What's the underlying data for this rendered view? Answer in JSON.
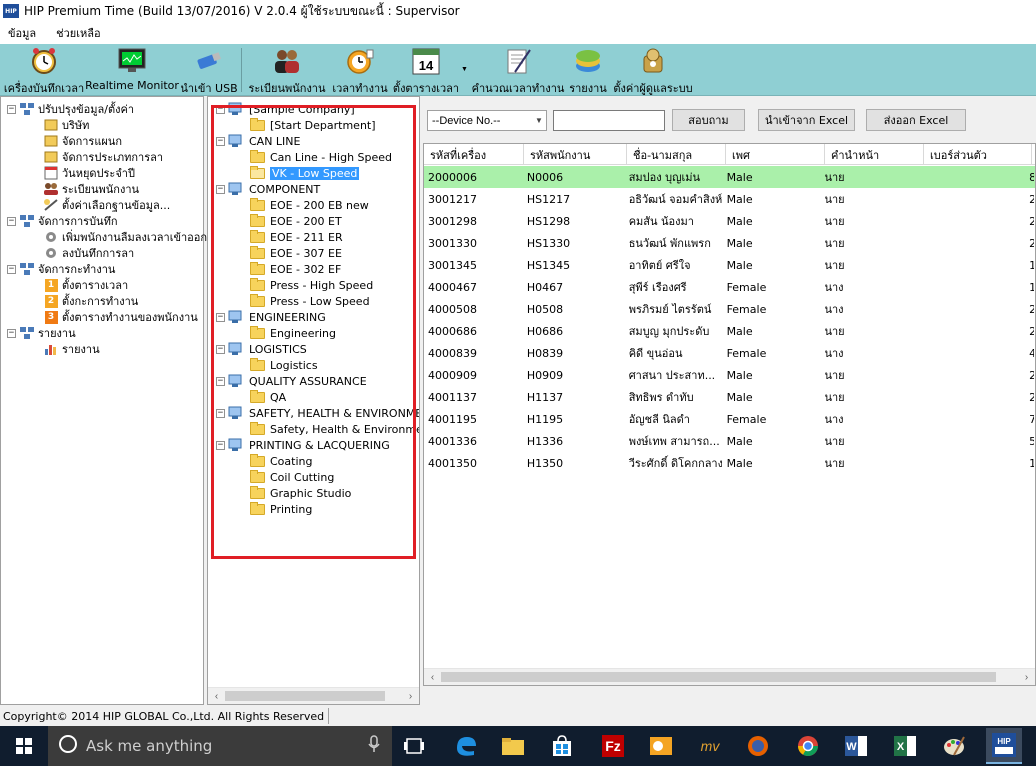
{
  "window": {
    "title": "HIP Premium Time (Build 13/07/2016) V 2.0.4   ผู้ใช้ระบบขณะนี้ : Supervisor",
    "app_icon_text": "HIP"
  },
  "menu": [
    "ข้อมูล",
    "ช่วยเหลือ"
  ],
  "toolbar": [
    {
      "label": "เครื่องบันทึกเวลา",
      "icon": "alarm-clock-icon"
    },
    {
      "label": "Realtime Monitor",
      "icon": "monitor-icon"
    },
    {
      "label": "นำเข้า USB",
      "icon": "usb-icon"
    },
    {
      "label": "ระเบียนพนักงาน",
      "icon": "users-icon"
    },
    {
      "label": "เวลาทำงาน",
      "icon": "clock-icon"
    },
    {
      "label": "ตั้งตารางเวลา",
      "icon": "calendar-icon",
      "calendar_day": "14"
    },
    {
      "label": "คำนวณเวลาทำงาน",
      "icon": "calculate-icon"
    },
    {
      "label": "รายงาน",
      "icon": "report-icon"
    },
    {
      "label": "ตั้งค่าผู้ดูแลระบบ",
      "icon": "admin-settings-icon"
    }
  ],
  "nav": {
    "groups": [
      {
        "label": "ปรับปรุงข้อมูล/ตั้งค่า",
        "items": [
          "บริษัท",
          "จัดการแผนก",
          "จัดการประเภทการลา",
          "วันหยุดประจำปี",
          "ระเบียนพนักงาน",
          "ตั้งค่าเลือกฐานข้อมูล..."
        ]
      },
      {
        "label": "จัดการการบันทึก",
        "items": [
          "เพิ่มพนักงานลืมลงเวลาเข้าออก",
          "ลงบันทึกการลา"
        ]
      },
      {
        "label": "จัดการกะทำงาน",
        "items": [
          "ตั้งตารางเวลา",
          "ตั้งกะการทำงาน",
          "ตั้งตารางทำงานของพนักงาน"
        ],
        "badges": [
          "1",
          "2",
          "3"
        ]
      },
      {
        "label": "รายงาน",
        "items": [
          "รายงาน"
        ]
      }
    ]
  },
  "tree": {
    "nodes": [
      {
        "label": "[Sample Company]",
        "level": 0,
        "type": "computer"
      },
      {
        "label": "[Start Department]",
        "level": 1,
        "type": "folder"
      },
      {
        "label": "CAN LINE",
        "level": 0,
        "type": "computer"
      },
      {
        "label": "Can Line - High Speed",
        "level": 1,
        "type": "folder"
      },
      {
        "label": "VK - Low Speed",
        "level": 1,
        "type": "folder-open",
        "selected": true
      },
      {
        "label": "COMPONENT",
        "level": 0,
        "type": "computer"
      },
      {
        "label": "EOE - 200 EB new",
        "level": 1,
        "type": "folder"
      },
      {
        "label": "EOE - 200 ET",
        "level": 1,
        "type": "folder"
      },
      {
        "label": "EOE - 211 ER",
        "level": 1,
        "type": "folder"
      },
      {
        "label": "EOE - 307 EE",
        "level": 1,
        "type": "folder"
      },
      {
        "label": "EOE - 302 EF",
        "level": 1,
        "type": "folder"
      },
      {
        "label": "Press - High Speed",
        "level": 1,
        "type": "folder"
      },
      {
        "label": "Press - Low Speed",
        "level": 1,
        "type": "folder"
      },
      {
        "label": "ENGINEERING",
        "level": 0,
        "type": "computer"
      },
      {
        "label": "Engineering",
        "level": 1,
        "type": "folder"
      },
      {
        "label": "LOGISTICS",
        "level": 0,
        "type": "computer"
      },
      {
        "label": "Logistics",
        "level": 1,
        "type": "folder"
      },
      {
        "label": "QUALITY ASSURANCE",
        "level": 0,
        "type": "computer"
      },
      {
        "label": "QA",
        "level": 1,
        "type": "folder"
      },
      {
        "label": "SAFETY, HEALTH & ENVIRONMENT",
        "level": 0,
        "type": "computer"
      },
      {
        "label": "Safety, Health & Environment",
        "level": 1,
        "type": "folder"
      },
      {
        "label": "PRINTING & LACQUERING",
        "level": 0,
        "type": "computer"
      },
      {
        "label": "Coating",
        "level": 1,
        "type": "folder"
      },
      {
        "label": "Coil Cutting",
        "level": 1,
        "type": "folder"
      },
      {
        "label": "Graphic Studio",
        "level": 1,
        "type": "folder"
      },
      {
        "label": "Printing",
        "level": 1,
        "type": "folder"
      }
    ]
  },
  "filter": {
    "device_select": "--Device No.--",
    "search_value": "",
    "query_button": "สอบถาม",
    "import_button": "นำเข้าจาก Excel",
    "export_button": "ส่งออก Excel"
  },
  "grid": {
    "columns": [
      "รหัสที่เครื่อง",
      "รหัสพนักงาน",
      "ชื่อ-นามสกุล",
      "เพศ",
      "คำนำหน้า",
      "เบอร์ส่วนตัว",
      "ส"
    ],
    "rows": [
      [
        "2000006",
        "N0006",
        "สมปอง บุญเม่น",
        "Male",
        "นาย",
        "",
        "8"
      ],
      [
        "3001217",
        "HS1217",
        "อธิวัฒน์ จอมคำสิงห์",
        "Male",
        "นาย",
        "",
        "2"
      ],
      [
        "3001298",
        "HS1298",
        "คมสัน น้องมา",
        "Male",
        "นาย",
        "",
        "2"
      ],
      [
        "3001330",
        "HS1330",
        "ธนวัฒน์ พักแพรก",
        "Male",
        "นาย",
        "",
        "2"
      ],
      [
        "3001345",
        "HS1345",
        "อาทิตย์ ศรีใจ",
        "Male",
        "นาย",
        "",
        "1"
      ],
      [
        "4000467",
        "H0467",
        "สุพีร์ เรืองศรี",
        "Female",
        "นาง",
        "",
        "1"
      ],
      [
        "4000508",
        "H0508",
        "พรภิรมย์ ไตรรัตน์",
        "Female",
        "นาง",
        "",
        "2"
      ],
      [
        "4000686",
        "H0686",
        "สมบูญ มุกประดับ",
        "Male",
        "นาย",
        "",
        "2"
      ],
      [
        "4000839",
        "H0839",
        "คิดี ขุนอ่อน",
        "Female",
        "นาง",
        "",
        "4"
      ],
      [
        "4000909",
        "H0909",
        "ศาสนา ประสาท...",
        "Male",
        "นาย",
        "",
        "2"
      ],
      [
        "4001137",
        "H1137",
        "สิทธิพร ดำทับ",
        "Male",
        "นาย",
        "",
        "2"
      ],
      [
        "4001195",
        "H1195",
        "อัญชลี นิลดำ",
        "Female",
        "นาง",
        "",
        "7"
      ],
      [
        "4001336",
        "H1336",
        "พงษ์เทพ สามารถ...",
        "Male",
        "นาย",
        "",
        "5"
      ],
      [
        "4001350",
        "H1350",
        "วีระศักดิ์ ดิโคกกลาง",
        "Male",
        "นาย",
        "",
        "1"
      ]
    ]
  },
  "status": {
    "copyright": "Copyright© 2014 HIP GLOBAL Co.,Ltd. All Rights Reserved"
  },
  "taskbar": {
    "search_placeholder": "Ask me anything",
    "apps": [
      "task-view-icon",
      "edge-icon",
      "file-explorer-icon",
      "store-icon",
      "filezilla-icon",
      "outlook-icon",
      "mv-icon",
      "firefox-icon",
      "chrome-icon",
      "word-icon",
      "excel-icon",
      "paint-icon",
      "hip-app-icon"
    ],
    "colors": {
      "accent_toolbar": "#8fcfd3",
      "highlight_border": "#e01e25",
      "row_highlight": "#aaf0aa",
      "selection": "#3399ff"
    }
  }
}
